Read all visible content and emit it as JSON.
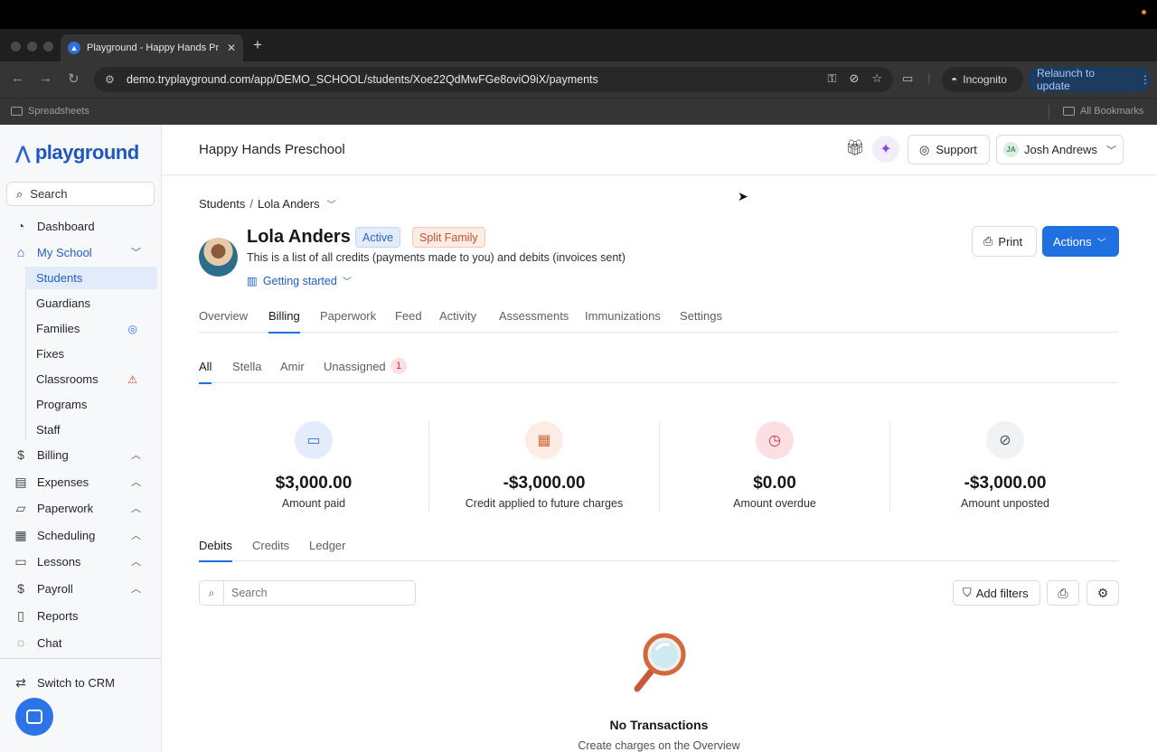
{
  "browser": {
    "tab_title": "Playground - Happy Hands Pr",
    "url": "demo.tryplayground.com/app/DEMO_SCHOOL/students/Xoe22QdMwFGe8oviO9iX/payments",
    "incognito_label": "Incognito",
    "relaunch_label": "Relaunch to update",
    "bookmark_left": "Spreadsheets",
    "bookmark_right": "All Bookmarks"
  },
  "sidebar": {
    "logo_text": "playground",
    "search_placeholder": "Search",
    "items": [
      {
        "label": "Dashboard",
        "icon": "dashboard-icon"
      },
      {
        "label": "My School",
        "icon": "home-icon"
      },
      {
        "label": "Billing",
        "icon": "dollar-icon"
      },
      {
        "label": "Expenses",
        "icon": "card-icon"
      },
      {
        "label": "Paperwork",
        "icon": "paperwork-icon"
      },
      {
        "label": "Scheduling",
        "icon": "calendar-icon"
      },
      {
        "label": "Lessons",
        "icon": "folder-icon"
      },
      {
        "label": "Payroll",
        "icon": "dollar-sign-icon"
      },
      {
        "label": "Reports",
        "icon": "report-icon"
      },
      {
        "label": "Chat",
        "icon": "chat-icon"
      }
    ],
    "sub_items": [
      "Students",
      "Guardians",
      "Families",
      "Fixes",
      "Classrooms",
      "Programs",
      "Staff"
    ],
    "switch_crm": "Switch to CRM"
  },
  "header": {
    "school_name": "Happy Hands Preschool",
    "support_label": "Support",
    "user_initials": "JA",
    "user_name": "Josh Andrews"
  },
  "breadcrumb": {
    "root": "Students",
    "separator": "/",
    "current": "Lola Anders"
  },
  "student": {
    "name": "Lola Anders",
    "badge_active": "Active",
    "badge_split": "Split Family",
    "description": "This is a list of all credits (payments made to you) and debits (invoices sent)",
    "getting_started": "Getting started"
  },
  "buttons": {
    "print": "Print",
    "actions": "Actions",
    "add_filters": "Add filters"
  },
  "main_tabs": [
    "Overview",
    "Billing",
    "Paperwork",
    "Feed",
    "Activity",
    "Assessments",
    "Immunizations",
    "Settings"
  ],
  "family_tabs": {
    "all": "All",
    "a": "Stella",
    "b": "Amir",
    "unassigned": "Unassigned",
    "unassigned_count": "1"
  },
  "stats": [
    {
      "amount": "$3,000.00",
      "label": "Amount paid",
      "color": "#e3ecfb"
    },
    {
      "amount": "-$3,000.00",
      "label": "Credit applied to future charges",
      "color": "#fdece4"
    },
    {
      "amount": "$0.00",
      "label": "Amount overdue",
      "color": "#fbdfe2"
    },
    {
      "amount": "-$3,000.00",
      "label": "Amount unposted",
      "color": "#f1f2f4"
    }
  ],
  "ledger_tabs": [
    "Debits",
    "Credits",
    "Ledger"
  ],
  "table_search_placeholder": "Search",
  "empty": {
    "title": "No Transactions",
    "subtitle": "Create charges on the Overview"
  },
  "colors": {
    "accent": "#2170df",
    "sidebar_active": "#2160c4"
  }
}
